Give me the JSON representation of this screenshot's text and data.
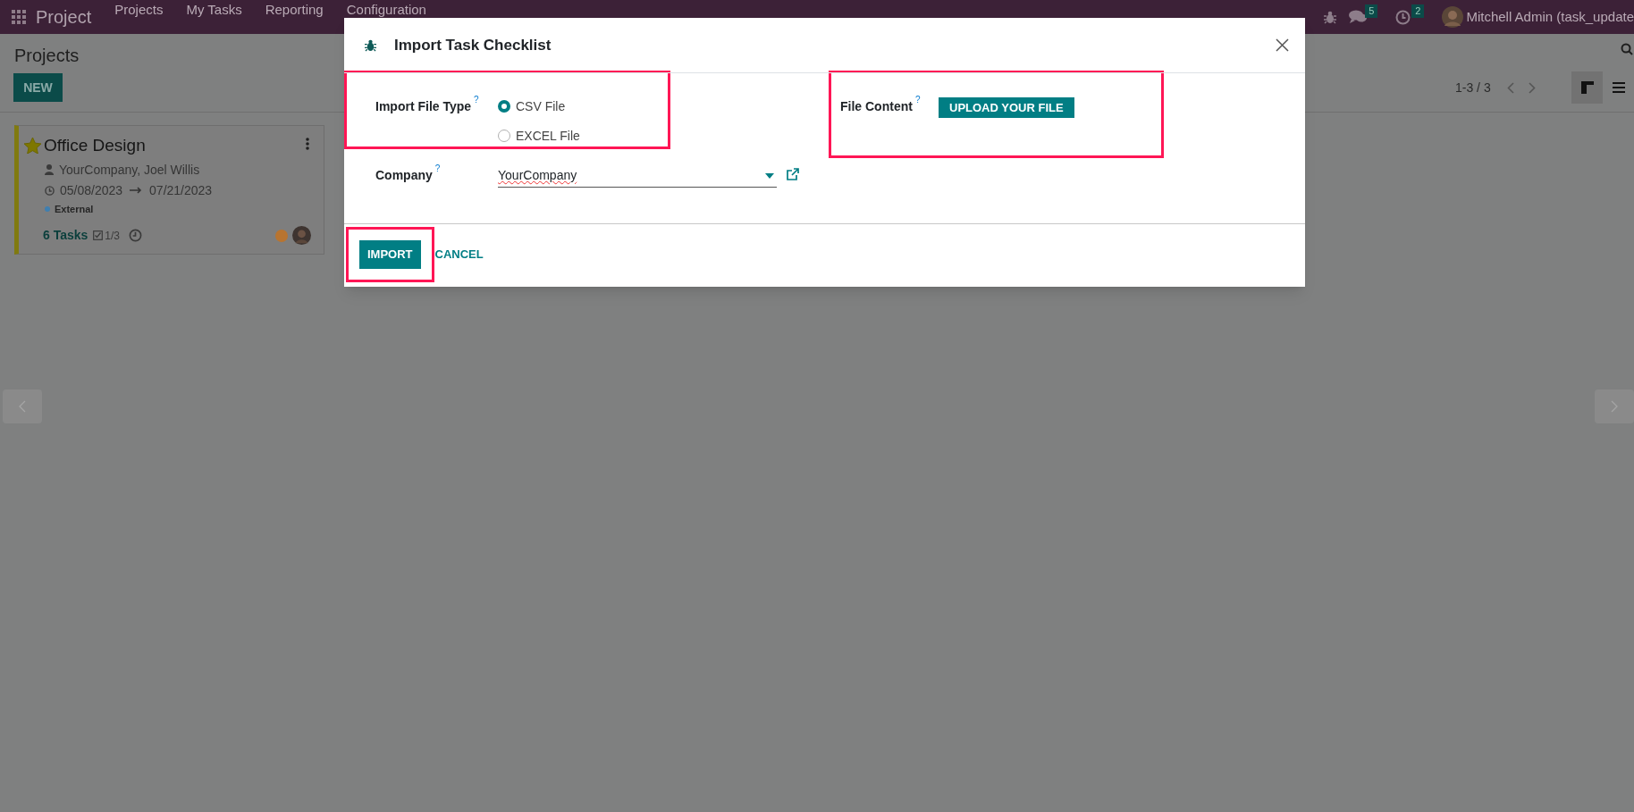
{
  "navbar": {
    "app_name": "Project",
    "menu": [
      "Projects",
      "My Tasks",
      "Reporting",
      "Configuration"
    ],
    "messages_count": "5",
    "activities_count": "2",
    "user": "Mitchell Admin (task_update"
  },
  "control_panel": {
    "title": "Projects",
    "new_button": "NEW",
    "pager": "1-3 / 3",
    "views": [
      {
        "kind": "kanban",
        "selected": true
      },
      {
        "kind": "list",
        "selected": false
      }
    ]
  },
  "cards": [
    {
      "name": "Office Design",
      "starred": true,
      "customer": "YourCompany, Joel Willis",
      "start": "05/08/2023",
      "end": "07/21/2023",
      "tag": {
        "label": "External",
        "color": "#3f7fb0"
      },
      "tasks": "6 Tasks",
      "checklist": "1/3",
      "status": {
        "color": "#b87430"
      }
    }
  ],
  "dialog": {
    "title": "Import Task Checklist",
    "fields": [
      {
        "kind": "radio",
        "label": "Import File Type",
        "help": "?",
        "highlighted": true,
        "options": [
          {
            "label": "CSV File",
            "selected": true
          },
          {
            "label": "EXCEL File",
            "selected": false
          }
        ]
      },
      {
        "kind": "upload",
        "label": "File Content",
        "help": "?",
        "highlighted": true,
        "button": "UPLOAD YOUR FILE"
      },
      {
        "kind": "select",
        "label": "Company",
        "help": "?",
        "highlighted": false,
        "value": "YourCompany"
      }
    ],
    "buttons": [
      {
        "label": "IMPORT",
        "kind": "primary",
        "highlighted": true
      },
      {
        "label": "CANCEL",
        "kind": "link",
        "highlighted": false
      }
    ]
  }
}
